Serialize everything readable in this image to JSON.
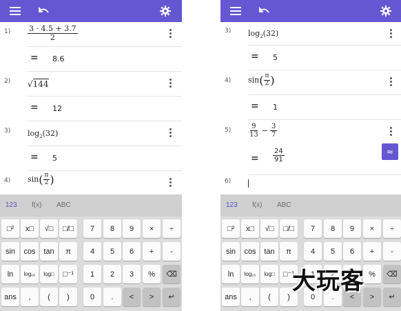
{
  "icons": {
    "menu": "hamburger-menu-icon",
    "undo": "undo-icon",
    "settings": "gear-icon",
    "more": "more-vertical-icon"
  },
  "colors": {
    "accent": "#6557d2",
    "keyboard_bg": "#dcdcdc"
  },
  "left": {
    "rows": [
      {
        "index": "1)",
        "expr": {
          "numerator": "3 · 4.5 + 3.7",
          "denominator": "2"
        },
        "result": "8.6"
      },
      {
        "index": "2)",
        "expr": {
          "radical": "√",
          "radicand": "144"
        },
        "result": "12"
      },
      {
        "index": "3)",
        "expr": {
          "func": "log",
          "base": "2",
          "arg": "(32)"
        },
        "result": "5"
      },
      {
        "index": "4)",
        "expr": {
          "func": "sin",
          "open": "(",
          "numerator": "π",
          "denominator": "2",
          "close": ")"
        }
      }
    ]
  },
  "right": {
    "rows": [
      {
        "index": "3)",
        "expr": {
          "func": "log",
          "base": "2",
          "arg": "(32)"
        },
        "result": "5"
      },
      {
        "index": "4)",
        "expr": {
          "func": "sin",
          "open": "(",
          "numerator": "π",
          "denominator": "2",
          "close": ")"
        },
        "result": "1"
      },
      {
        "index": "5)",
        "expr": {
          "a_num": "9",
          "a_den": "13",
          "op": "−",
          "b_num": "3",
          "b_den": "7"
        },
        "result": {
          "numerator": "24",
          "denominator": "91"
        },
        "approx_label": "≈"
      },
      {
        "index": "6)"
      }
    ]
  },
  "equals": "=",
  "keyboard": {
    "tabs": [
      "123",
      "f(x)",
      "ABC"
    ],
    "rows": [
      [
        "□²",
        "x□",
        "√□",
        "□/□",
        "7",
        "8",
        "9",
        "×",
        "÷"
      ],
      [
        "sin",
        "cos",
        "tan",
        "π",
        "4",
        "5",
        "6",
        "+",
        "-"
      ],
      [
        "ln",
        "log₁₀",
        "log□",
        "□⁻¹",
        "1",
        "2",
        "3",
        "%",
        "⌫"
      ],
      [
        "ans",
        ",",
        "(",
        ")",
        "0",
        ".",
        "<",
        ">",
        "↵"
      ]
    ]
  },
  "watermark": "大玩客"
}
